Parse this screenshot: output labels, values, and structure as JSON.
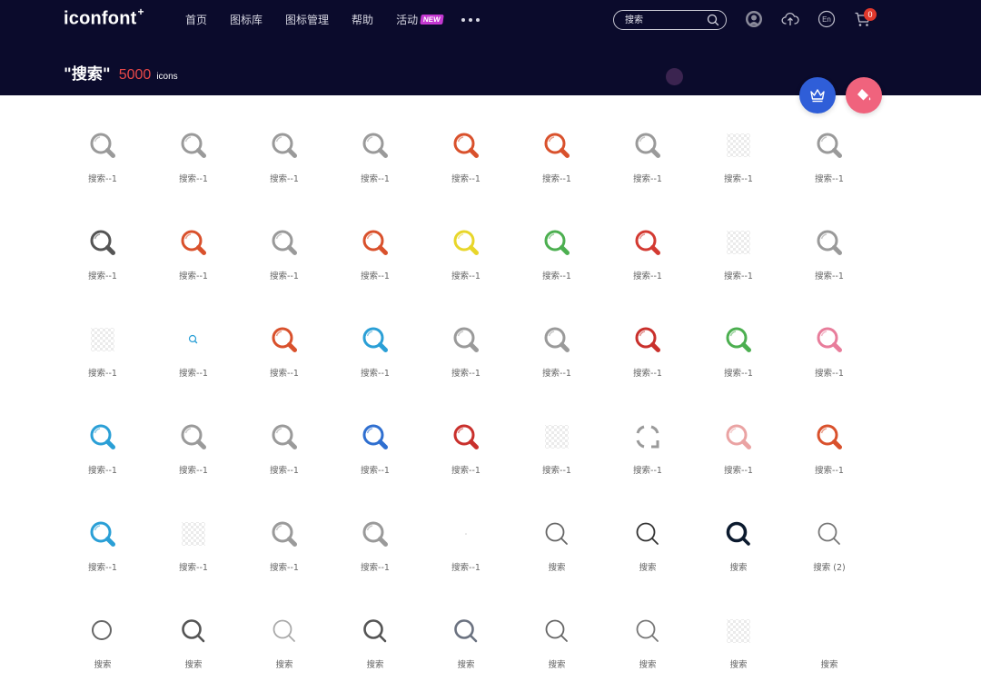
{
  "header": {
    "logo": "iconfont",
    "logo_plus": "+",
    "nav": [
      {
        "label": "首页"
      },
      {
        "label": "图标库"
      },
      {
        "label": "图标管理"
      },
      {
        "label": "帮助"
      },
      {
        "label": "活动",
        "badge": "NEW"
      }
    ],
    "search": {
      "value": "",
      "placeholder": "搜索"
    },
    "lang_label": "En",
    "cart_count": "0",
    "colors": {
      "bg": "#0b0b2c",
      "badge": "#c338d0",
      "cart_badge": "#e0382c"
    }
  },
  "results": {
    "query": "\"搜索\"",
    "count": "5000",
    "unit": "icons",
    "count_color": "#e84848"
  },
  "fabs": [
    {
      "name": "crown-icon",
      "color": "#2f5ed8"
    },
    {
      "name": "paint-bucket-icon",
      "color": "#f0637d"
    }
  ],
  "icons": [
    {
      "label": "搜索--1",
      "style": "glossy",
      "color": "#9a9a9a"
    },
    {
      "label": "搜索--1",
      "style": "glossy",
      "color": "#9a9a9a"
    },
    {
      "label": "搜索--1",
      "style": "glossy",
      "color": "#9a9a9a"
    },
    {
      "label": "搜索--1",
      "style": "glossy",
      "color": "#9a9a9a"
    },
    {
      "label": "搜索--1",
      "style": "glossy",
      "color": "#d9512c"
    },
    {
      "label": "搜索--1",
      "style": "glossy",
      "color": "#d9512c"
    },
    {
      "label": "搜索--1",
      "style": "glossy",
      "color": "#9a9a9a"
    },
    {
      "label": "搜索--1",
      "style": "checker",
      "color": "#dddddd"
    },
    {
      "label": "搜索--1",
      "style": "glossy",
      "color": "#9a9a9a"
    },
    {
      "label": "搜索--1",
      "style": "glossy",
      "color": "#555555"
    },
    {
      "label": "搜索--1",
      "style": "glossy",
      "color": "#d9512c"
    },
    {
      "label": "搜索--1",
      "style": "glossy",
      "color": "#9a9a9a"
    },
    {
      "label": "搜索--1",
      "style": "glossy",
      "color": "#d9512c"
    },
    {
      "label": "搜索--1",
      "style": "glossy",
      "color": "#e8d62a"
    },
    {
      "label": "搜索--1",
      "style": "glossy",
      "color": "#4caf50"
    },
    {
      "label": "搜索--1",
      "style": "glossy",
      "color": "#d33a32"
    },
    {
      "label": "搜索--1",
      "style": "checker",
      "color": "#dddddd"
    },
    {
      "label": "搜索--1",
      "style": "glossy",
      "color": "#9a9a9a"
    },
    {
      "label": "搜索--1",
      "style": "checker",
      "color": "#dddddd"
    },
    {
      "label": "搜索--1",
      "style": "tiny",
      "color": "#2a9fd6"
    },
    {
      "label": "搜索--1",
      "style": "glossy",
      "color": "#d9512c"
    },
    {
      "label": "搜索--1",
      "style": "glossy",
      "color": "#2a9fd6"
    },
    {
      "label": "搜索--1",
      "style": "glossy",
      "color": "#9a9a9a"
    },
    {
      "label": "搜索--1",
      "style": "glossy",
      "color": "#9a9a9a"
    },
    {
      "label": "搜索--1",
      "style": "glossy",
      "color": "#c9302c"
    },
    {
      "label": "搜索--1",
      "style": "glossy",
      "color": "#4caf50"
    },
    {
      "label": "搜索--1",
      "style": "glossy",
      "color": "#e87d9b"
    },
    {
      "label": "搜索--1",
      "style": "glossy",
      "color": "#2a9fd6"
    },
    {
      "label": "搜索--1",
      "style": "glossy",
      "color": "#9a9a9a"
    },
    {
      "label": "搜索--1",
      "style": "glossy",
      "color": "#9a9a9a"
    },
    {
      "label": "搜索--1",
      "style": "glossy",
      "color": "#2f6fd0"
    },
    {
      "label": "搜索--1",
      "style": "glossy",
      "color": "#c9302c"
    },
    {
      "label": "搜索--1",
      "style": "checker",
      "color": "#dddddd"
    },
    {
      "label": "搜索--1",
      "style": "bracket",
      "color": "#9a9a9a"
    },
    {
      "label": "搜索--1",
      "style": "glossy",
      "color": "#eaa3a3"
    },
    {
      "label": "搜索--1",
      "style": "glossy",
      "color": "#d9512c"
    },
    {
      "label": "搜索--1",
      "style": "glossy",
      "color": "#2a9fd6"
    },
    {
      "label": "搜索--1",
      "style": "checker",
      "color": "#dddddd"
    },
    {
      "label": "搜索--1",
      "style": "glossy",
      "color": "#9a9a9a"
    },
    {
      "label": "搜索--1",
      "style": "glossy",
      "color": "#9a9a9a"
    },
    {
      "label": "搜索--1",
      "style": "dot",
      "color": "#cccccc"
    },
    {
      "label": "搜索",
      "style": "outline",
      "color": "#666666"
    },
    {
      "label": "搜索",
      "style": "outline",
      "color": "#333333"
    },
    {
      "label": "搜索",
      "style": "bold",
      "color": "#0b1a2e"
    },
    {
      "label": "搜索 (2)",
      "style": "outline",
      "color": "#777777"
    },
    {
      "label": "搜索",
      "style": "ring",
      "color": "#666666"
    },
    {
      "label": "搜索",
      "style": "thick",
      "color": "#555555"
    },
    {
      "label": "搜索",
      "style": "outline",
      "color": "#aaaaaa"
    },
    {
      "label": "搜索",
      "style": "thick",
      "color": "#555555"
    },
    {
      "label": "搜索",
      "style": "thick",
      "color": "#6b7280"
    },
    {
      "label": "搜索",
      "style": "outline",
      "color": "#666666"
    },
    {
      "label": "搜索",
      "style": "outline",
      "color": "#777777"
    },
    {
      "label": "搜索",
      "style": "checker",
      "color": "#dddddd"
    },
    {
      "label": "搜索",
      "style": "none",
      "color": "#ffffff"
    }
  ]
}
